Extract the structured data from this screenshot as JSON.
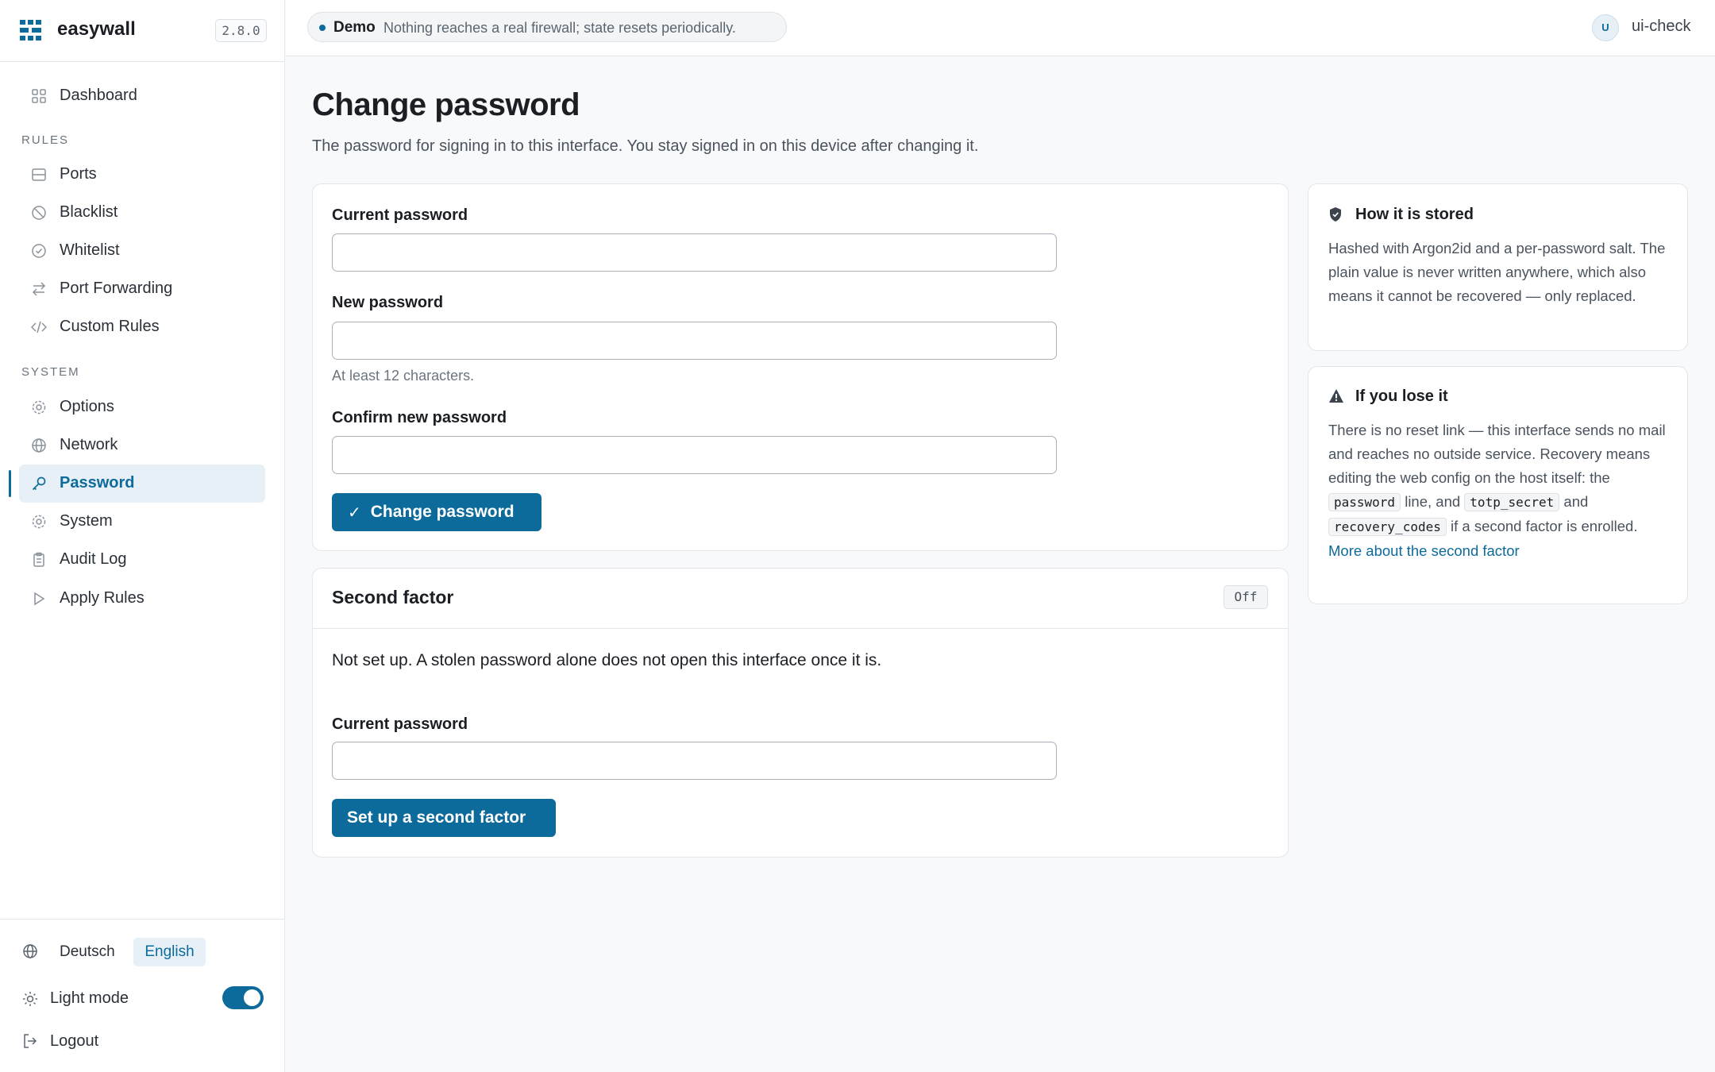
{
  "app": {
    "name": "easywall",
    "version": "2.8.0"
  },
  "sidebar": {
    "dashboard": "Dashboard",
    "rules_section": "RULES",
    "rules": [
      "Ports",
      "Blacklist",
      "Whitelist",
      "Port Forwarding",
      "Custom Rules"
    ],
    "system_section": "SYSTEM",
    "system": [
      "Options",
      "Network",
      "Password",
      "System",
      "Audit Log",
      "Apply Rules"
    ],
    "active_item": "Password",
    "languages": [
      "Deutsch",
      "English"
    ],
    "selected_language": "English",
    "theme_label": "Light mode",
    "theme_toggle_on": true,
    "logout": "Logout"
  },
  "topbar": {
    "demo_label": "Demo",
    "demo_text": "Nothing reaches a real firewall; state resets periodically.",
    "user_initial": "U",
    "user_name": "ui-check"
  },
  "page": {
    "title": "Change password",
    "subtitle": "The password for signing in to this interface. You stay signed in on this device after changing it."
  },
  "change_form": {
    "current_label": "Current password",
    "current_value": "",
    "new_label": "New password",
    "new_value": "",
    "new_hint": "At least 12 characters.",
    "confirm_label": "Confirm new password",
    "confirm_value": "",
    "submit_label": "Change password"
  },
  "second_factor": {
    "title": "Second factor",
    "status": "Off",
    "description": "Not set up. A stolen password alone does not open this interface once it is.",
    "current_label": "Current password",
    "current_value": "",
    "button_label": "Set up a second factor"
  },
  "aside": {
    "stored": {
      "title": "How it is stored",
      "body": "Hashed with Argon2id and a per-password salt. The plain value is never written anywhere, which also means it cannot be recovered — only replaced."
    },
    "lose": {
      "title": "If you lose it",
      "text1": "There is no reset link — this interface sends no mail and reaches no outside service. Recovery means editing the web config on the host itself: the",
      "code1": "password",
      "text2": "line, and",
      "code2": "totp_secret",
      "text3": "and",
      "code3": "recovery_codes",
      "text4": "if a second factor is enrolled.",
      "link": "More about the second factor"
    }
  },
  "colors": {
    "accent": "#0d6b9c",
    "accent_soft": "#e6f0f6"
  },
  "icons": {
    "brand": "easywall-logo-icon",
    "dashboard": "grid-icon",
    "ports": "server-icon",
    "blacklist": "ban-icon",
    "whitelist": "check-circle-icon",
    "forwarding": "arrows-swap-icon",
    "custom": "code-icon",
    "options": "gear-icon",
    "network": "globe-icon",
    "password": "key-icon",
    "system": "gear-icon",
    "audit": "clipboard-icon",
    "apply": "play-icon",
    "stored": "shield-icon",
    "lose": "warning-icon"
  }
}
